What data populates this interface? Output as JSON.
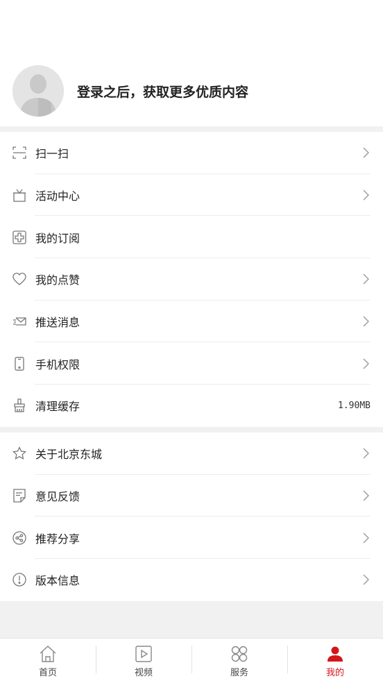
{
  "profile": {
    "login_prompt": "登录之后，获取更多优质内容"
  },
  "menu_group_1": [
    {
      "label": "扫一扫",
      "icon": "scan-icon",
      "chevron": true
    },
    {
      "label": "活动中心",
      "icon": "gift-icon",
      "chevron": true
    },
    {
      "label": "我的订阅",
      "icon": "subscribe-plus-icon",
      "chevron": false
    },
    {
      "label": "我的点赞",
      "icon": "heart-icon",
      "chevron": true
    },
    {
      "label": "推送消息",
      "icon": "message-icon",
      "chevron": true
    },
    {
      "label": "手机权限",
      "icon": "phone-icon",
      "chevron": true
    },
    {
      "label": "清理缓存",
      "icon": "brush-icon",
      "chevron": false,
      "value": "1.90MB"
    }
  ],
  "menu_group_2": [
    {
      "label": "关于北京东城",
      "icon": "star-icon",
      "chevron": true
    },
    {
      "label": "意见反馈",
      "icon": "feedback-icon",
      "chevron": true
    },
    {
      "label": "推荐分享",
      "icon": "share-icon",
      "chevron": true
    },
    {
      "label": "版本信息",
      "icon": "info-icon",
      "chevron": true
    }
  ],
  "tabbar": [
    {
      "label": "首页",
      "icon": "home-icon",
      "active": false
    },
    {
      "label": "视频",
      "icon": "video-icon",
      "active": false
    },
    {
      "label": "服务",
      "icon": "grid-icon",
      "active": false
    },
    {
      "label": "我的",
      "icon": "user-icon",
      "active": true
    }
  ],
  "colors": {
    "accent": "#d0161b",
    "icon_gray": "#777777",
    "background": "#f1f1f1"
  }
}
